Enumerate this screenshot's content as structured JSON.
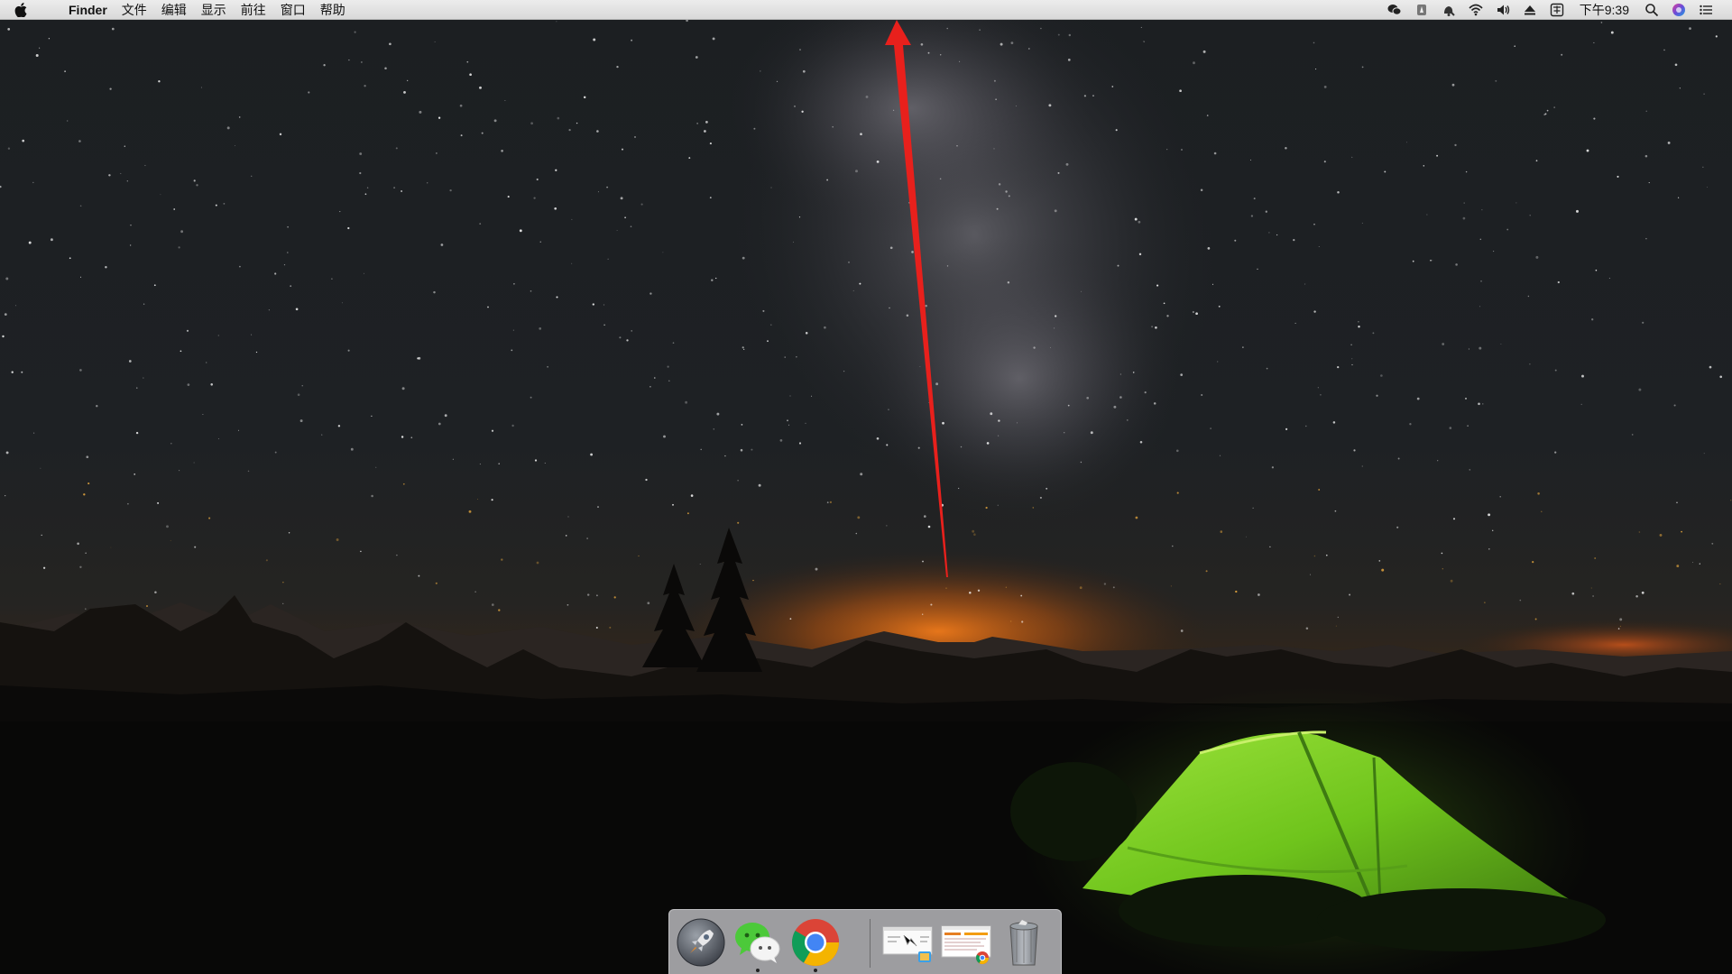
{
  "menubar": {
    "app_name": "Finder",
    "menus": [
      "文件",
      "编辑",
      "显示",
      "前往",
      "窗口",
      "帮助"
    ],
    "clock": "下午9:39",
    "status_icons": [
      "wechat-icon",
      "app-status-icon",
      "notification-icon",
      "wifi-icon",
      "volume-icon",
      "eject-icon",
      "input-method-icon",
      "spotlight-icon",
      "siri-icon",
      "notification-center-icon"
    ]
  },
  "dock": {
    "apps": [
      {
        "name": "launchpad",
        "running": false
      },
      {
        "name": "wechat",
        "running": true
      },
      {
        "name": "chrome",
        "running": true
      }
    ],
    "items": [
      "finder-window-thumbnail",
      "chrome-window-thumbnail",
      "trash"
    ]
  },
  "annotation": {
    "arrow_color": "#e8201c"
  },
  "colors": {
    "tent": "#7ed321",
    "horizon_glow": "#e86a10",
    "menubar": "#e3e3e3"
  }
}
